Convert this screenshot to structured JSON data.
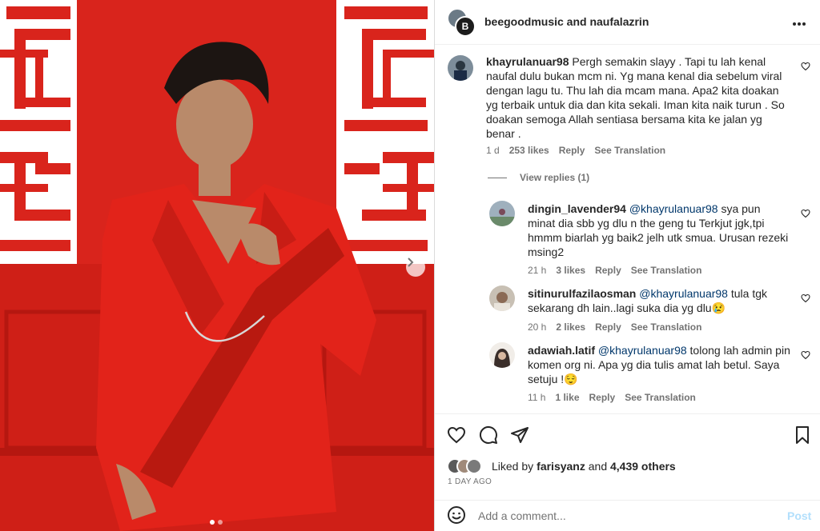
{
  "header": {
    "title": "beegoodmusic and naufalazrin",
    "avatar_letter": "B",
    "more_icon": "more-horizontal-icon"
  },
  "comments": [
    {
      "username": "khayrulanuar98",
      "mention": "",
      "text": "Pergh semakin slayy . Tapi tu lah kenal naufal dulu bukan mcm ni. Yg mana kenal dia sebelum viral dengan lagu tu. Thu lah dia mcam mana. Apa2 kita doakan yg terbaik untuk dia dan kita sekali. Iman kita naik turun . So doakan semoga Allah sentiasa bersama kita ke jalan yg benar .",
      "time": "1 d",
      "likes": "253 likes",
      "reply": "Reply",
      "translate": "See Translation"
    },
    {
      "username": "dingin_lavender94",
      "mention": "@khayrulanuar98",
      "text": "sya pun minat dia sbb yg dlu n the geng tu Terkjut jgk,tpi hmmm biarlah yg baik2 jelh utk smua. Urusan rezeki msing2",
      "time": "21 h",
      "likes": "3 likes",
      "reply": "Reply",
      "translate": "See Translation"
    },
    {
      "username": "sitinurulfazilaosman",
      "mention": "@khayrulanuar98",
      "text": "tula tgk sekarang dh lain..lagi suka dia yg dlu😢",
      "time": "20 h",
      "likes": "2 likes",
      "reply": "Reply",
      "translate": "See Translation"
    },
    {
      "username": "adawiah.latif",
      "mention": "@khayrulanuar98",
      "text": "tolong lah admin pin komen org ni. Apa yg dia tulis amat lah betul. Saya setuju !😌",
      "time": "11 h",
      "likes": "1 like",
      "reply": "Reply",
      "translate": "See Translation"
    }
  ],
  "view_replies": "View replies (1)",
  "actions": {
    "icons": [
      "heart-icon",
      "comment-icon",
      "share-icon",
      "bookmark-icon"
    ]
  },
  "likes": {
    "prefix": "Liked by ",
    "user": "farisyanz",
    "middle": " and ",
    "others": "4,439 others"
  },
  "date": "1 DAY AGO",
  "composer": {
    "placeholder": "Add a comment...",
    "post_label": "Post"
  },
  "carousel": {
    "slides": 2,
    "active": 1
  },
  "colors": {
    "photo_red": "#d9241c",
    "mention": "#00376b",
    "muted": "#737373",
    "post_disabled": "#b2dffc"
  }
}
